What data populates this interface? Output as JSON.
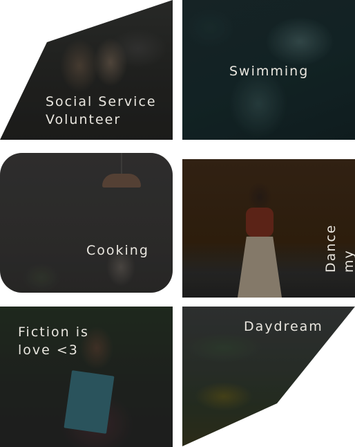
{
  "tiles": [
    {
      "label": "Social Service\nVolunteer"
    },
    {
      "label": "Swimming"
    },
    {
      "label": "Cooking"
    },
    {
      "label": "Dance my\nheart out"
    },
    {
      "label": "Fiction is\nlove <3"
    },
    {
      "label": "Daydream"
    }
  ],
  "colors": {
    "label_text": "#e9e6df",
    "page_background": "#ffffff"
  }
}
